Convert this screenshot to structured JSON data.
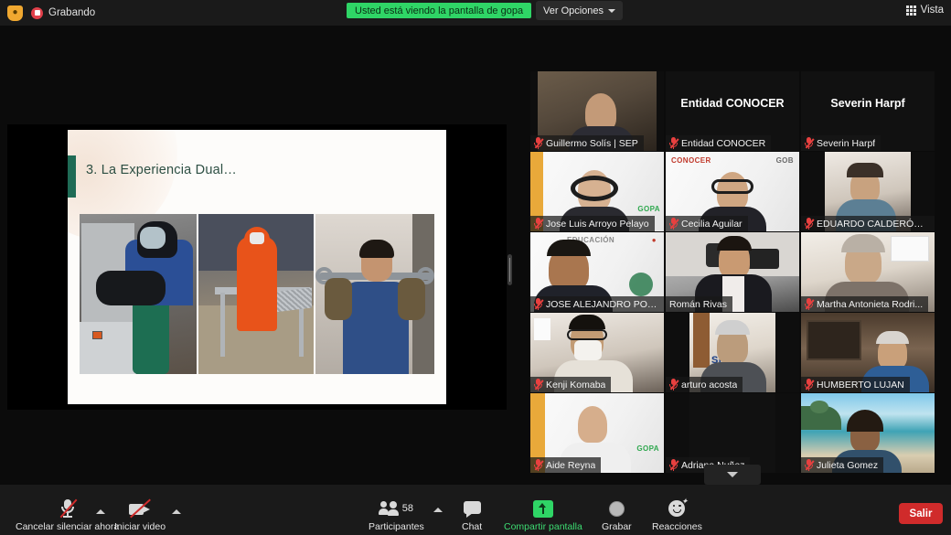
{
  "topbar": {
    "shield_icon": "shield-icon",
    "recording_label": "Grabando",
    "share_banner": "Usted está viendo la pantalla de gopa",
    "view_options_label": "Ver Opciones",
    "view_label": "Vista"
  },
  "shared_screen": {
    "slide_title": "3. La Experiencia Dual…",
    "accent_color": "#1f6b55",
    "title_color": "#2d4f43"
  },
  "gallery": {
    "active_speaker_color": "#bcd62e",
    "tiles": [
      {
        "name": "Guillermo Solís | SEP",
        "muted": true,
        "video_on": true,
        "active": false,
        "display_name": ""
      },
      {
        "name": "Entidad CONOCER",
        "muted": true,
        "video_on": false,
        "active": false,
        "display_name": "Entidad CONOCER"
      },
      {
        "name": "Severin Harpf",
        "muted": true,
        "video_on": false,
        "active": false,
        "display_name": "Severin Harpf"
      },
      {
        "name": "Jose Luis Arroyo Pelayo",
        "muted": true,
        "video_on": true,
        "active": false,
        "display_name": ""
      },
      {
        "name": "Cecilia Aguilar",
        "muted": true,
        "video_on": true,
        "active": false,
        "display_name": ""
      },
      {
        "name": "EDUARDO CALDERÓN (...",
        "muted": true,
        "video_on": true,
        "active": false,
        "display_name": ""
      },
      {
        "name": "JOSE ALEJANDRO PON...",
        "muted": true,
        "video_on": true,
        "active": false,
        "display_name": ""
      },
      {
        "name": "Román Rivas",
        "muted": false,
        "video_on": true,
        "active": true,
        "display_name": ""
      },
      {
        "name": "Martha Antonieta Rodri...",
        "muted": true,
        "video_on": true,
        "active": false,
        "display_name": ""
      },
      {
        "name": "Kenji Komaba",
        "muted": true,
        "video_on": true,
        "active": false,
        "display_name": ""
      },
      {
        "name": "arturo acosta",
        "muted": true,
        "video_on": true,
        "active": false,
        "display_name": ""
      },
      {
        "name": "HUMBERTO LUJAN",
        "muted": true,
        "video_on": true,
        "active": false,
        "display_name": ""
      },
      {
        "name": "Aide Reyna",
        "muted": true,
        "video_on": true,
        "active": false,
        "display_name": ""
      },
      {
        "name": "Adriana Nuñez",
        "muted": true,
        "video_on": false,
        "active": false,
        "display_name": ""
      },
      {
        "name": "Julieta Gomez",
        "muted": true,
        "video_on": true,
        "active": false,
        "display_name": ""
      }
    ],
    "next_page_icon": "chevron-down-icon"
  },
  "toolbar": {
    "mute_label": "Cancelar silenciar ahora",
    "video_label": "Iniciar video",
    "participants_label": "Participantes",
    "participants_count": "58",
    "chat_label": "Chat",
    "share_label": "Compartir pantalla",
    "record_label": "Grabar",
    "reactions_label": "Reacciones",
    "leave_label": "Salir",
    "share_color": "#3ddc72",
    "leave_color": "#d02b2b"
  }
}
